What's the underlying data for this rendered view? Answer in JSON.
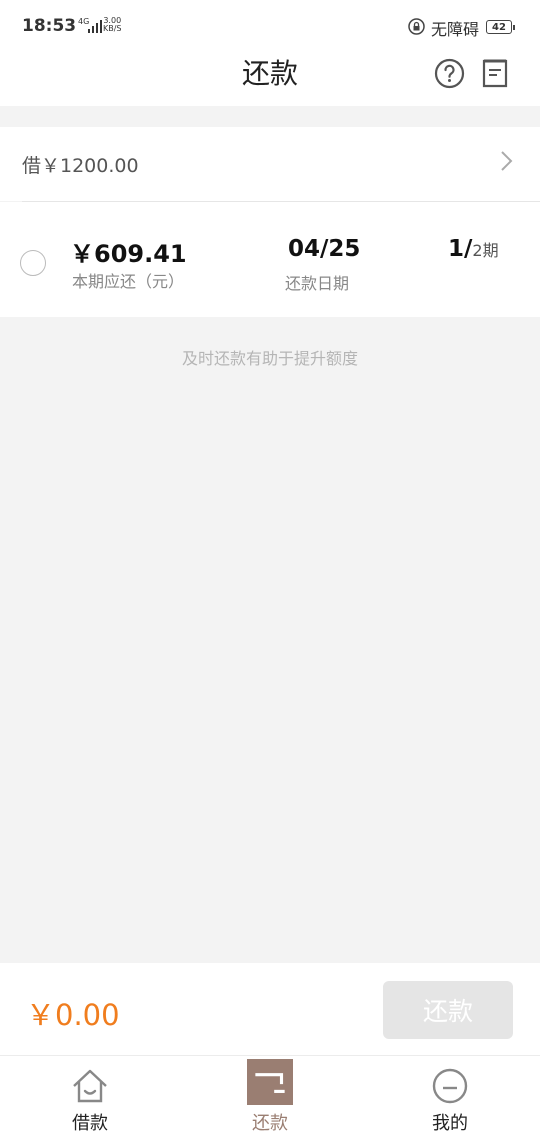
{
  "status_bar": {
    "time": "18:53",
    "network": "4G",
    "speed_value": "3.00",
    "speed_unit": "KB/S",
    "accessibility": "无障碍",
    "battery": "42"
  },
  "header": {
    "title": "还款",
    "help_icon": "question-circle-icon",
    "bill_icon": "bill-list-icon"
  },
  "loan": {
    "label": "借￥1200.00"
  },
  "installment": {
    "amount": "￥609.41",
    "amount_label": "本期应还（元）",
    "date": "04/25",
    "date_label": "还款日期",
    "period_current": "1/",
    "period_total": "2期",
    "selected": false
  },
  "hint": "及时还款有助于提升额度",
  "pay_bar": {
    "total": "￥0.00",
    "button_label": "还款"
  },
  "tabs": [
    {
      "label": "借款",
      "icon": "home-icon",
      "active": false
    },
    {
      "label": "还款",
      "icon": "repay-icon",
      "active": true
    },
    {
      "label": "我的",
      "icon": "profile-face-icon",
      "active": false
    }
  ],
  "colors": {
    "accent_orange": "#f07d1e",
    "active_tab": "#9a7e72",
    "disabled_button": "#e5e5e5",
    "background": "#f3f3f3"
  }
}
